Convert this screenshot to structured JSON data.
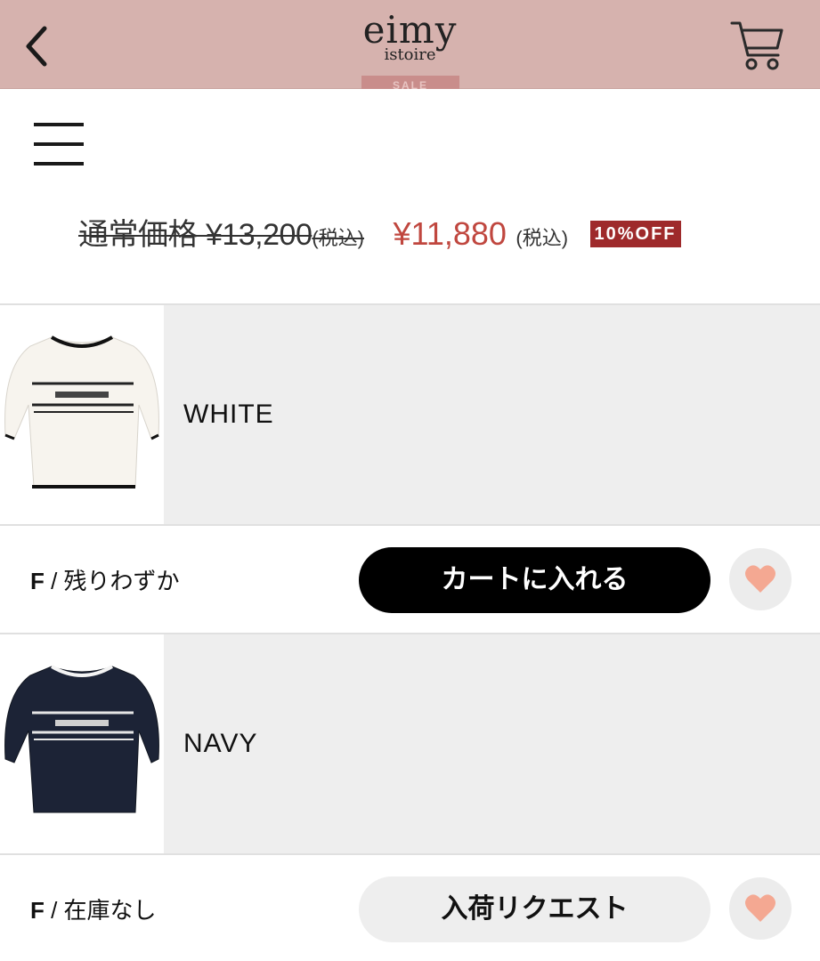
{
  "header": {
    "brand_main": "eimy",
    "brand_sub": "istoire",
    "sale_tag": "SALE",
    "back_icon": "chevron-left-icon",
    "cart_icon": "cart-icon",
    "background": "#d6b2ae"
  },
  "menu": {
    "icon": "hamburger-icon"
  },
  "price": {
    "regular_label": "通常価格 ¥13,200",
    "regular_tax": "(税込)",
    "sale_price": "¥11,880",
    "sale_tax": "(税込)",
    "discount_badge": "10%OFF",
    "sale_color": "#c0473f",
    "badge_color": "#9e2a2b"
  },
  "variants": [
    {
      "color": "WHITE",
      "thumb_icon": "white-knit-top-image",
      "size_code": "F",
      "size_status": " / 残りわずか",
      "button_label": "カートに入れる",
      "favorite_icon": "heart-icon"
    },
    {
      "color": "NAVY",
      "thumb_icon": "navy-knit-top-image",
      "size_code": "F",
      "size_status": " / 在庫なし",
      "button_label": "入荷リクエスト",
      "favorite_icon": "heart-icon"
    }
  ],
  "colors": {
    "heart": "#f4a892",
    "primary_button": "#000000",
    "secondary_button": "#eeeeee"
  }
}
